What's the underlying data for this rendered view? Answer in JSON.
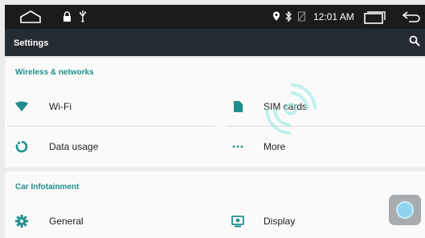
{
  "status_bar": {
    "time": "12:01 AM",
    "icons": [
      "home-icon",
      "lock-icon",
      "usb-icon",
      "location-icon",
      "bluetooth-icon",
      "no-signal-icon",
      "recents-icon",
      "back-icon"
    ]
  },
  "toolbar": {
    "title": "Settings",
    "search_icon": "search-icon"
  },
  "sections": [
    {
      "header": "Wireless & networks",
      "items": [
        {
          "label": "Wi-Fi",
          "icon": "wifi-icon"
        },
        {
          "label": "SIM cards",
          "icon": "sim-card-icon"
        },
        {
          "label": "Data usage",
          "icon": "data-usage-icon"
        },
        {
          "label": "More",
          "icon": "more-icon"
        }
      ]
    },
    {
      "header": "Car Infotainment",
      "items": [
        {
          "label": "General",
          "icon": "gear-icon"
        },
        {
          "label": "Display",
          "icon": "display-icon"
        }
      ]
    }
  ],
  "colors": {
    "accent": "#1f8f8c",
    "toolbar": "#242b33",
    "status_bar": "#1b1b1b",
    "background": "#ececec",
    "card": "#fafafa"
  }
}
